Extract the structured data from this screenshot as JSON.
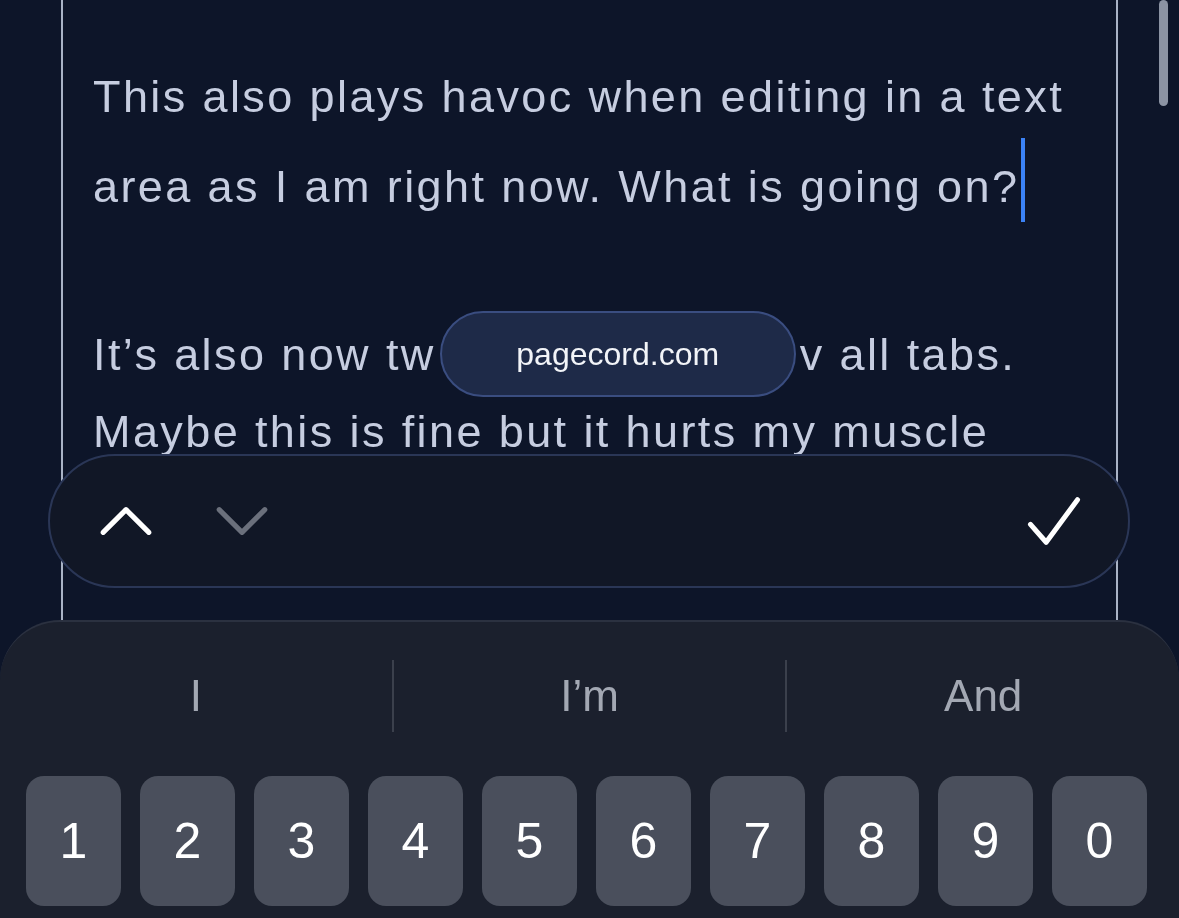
{
  "editor": {
    "paragraphs": [
      {
        "kind": "text",
        "text": "This also plays havoc when editing in a text area as I am right now. What is going on?",
        "caret": true
      },
      {
        "kind": "split",
        "before": "It’s also now tw",
        "after": "v all tabs."
      },
      {
        "kind": "text",
        "text": "Maybe this is fine but it hurts my muscle"
      }
    ]
  },
  "address_pill": {
    "text": "pagecord.com"
  },
  "find_bar": {
    "buttons": [
      {
        "kind": "up",
        "disabled": false
      },
      {
        "kind": "down",
        "disabled": true
      }
    ],
    "done": {
      "kind": "check"
    }
  },
  "keyboard": {
    "suggestions": [
      "I",
      "I’m",
      "And"
    ],
    "keys": [
      "1",
      "2",
      "3",
      "4",
      "5",
      "6",
      "7",
      "8",
      "9",
      "0"
    ]
  }
}
